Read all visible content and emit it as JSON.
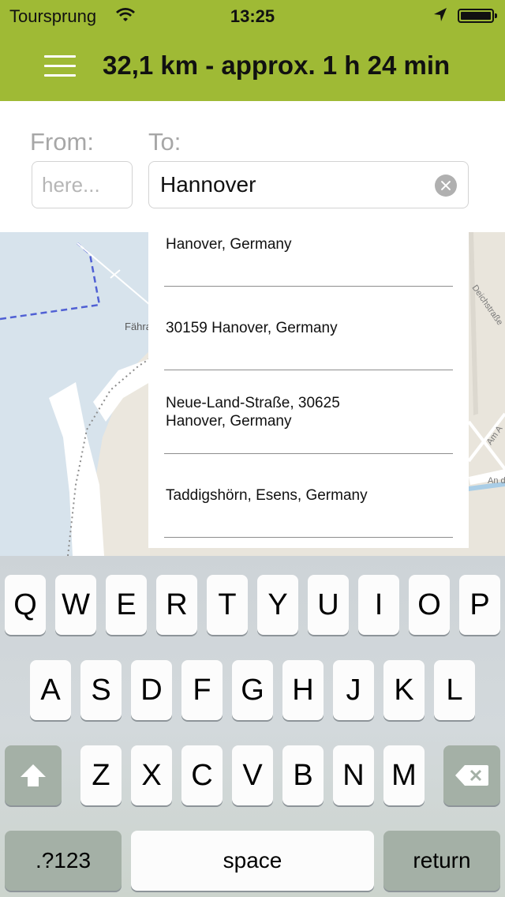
{
  "status_bar": {
    "carrier": "Toursprung",
    "time": "13:25"
  },
  "nav": {
    "title": "32,1 km - approx. 1 h 24 min"
  },
  "search": {
    "from_label": "From:",
    "from_placeholder": "here...",
    "to_label": "To:",
    "to_value": "Hannover"
  },
  "suggestions": [
    {
      "line1": "Hanover, Germany",
      "line2": ""
    },
    {
      "line1": "30159 Hanover, Germany",
      "line2": ""
    },
    {
      "line1": "Neue-Land-Straße, 30625",
      "line2": "Hanover, Germany"
    },
    {
      "line1": "Taddigshörn, Esens, Germany",
      "line2": ""
    }
  ],
  "map": {
    "label_ferry": "Fähra",
    "label_street_1": "Deichstraße",
    "label_street_2": "Am A",
    "label_street_3": "An d"
  },
  "keyboard": {
    "row1": [
      "Q",
      "W",
      "E",
      "R",
      "T",
      "Y",
      "U",
      "I",
      "O",
      "P"
    ],
    "row2": [
      "A",
      "S",
      "D",
      "F",
      "G",
      "H",
      "J",
      "K",
      "L"
    ],
    "row3": [
      "Z",
      "X",
      "C",
      "V",
      "B",
      "N",
      "M"
    ],
    "numbers_label": ".?123",
    "space_label": "space",
    "return_label": "return"
  },
  "colors": {
    "header_green": "#9fba35",
    "water": "#d6e3ec",
    "land": "#e9e5dc"
  }
}
